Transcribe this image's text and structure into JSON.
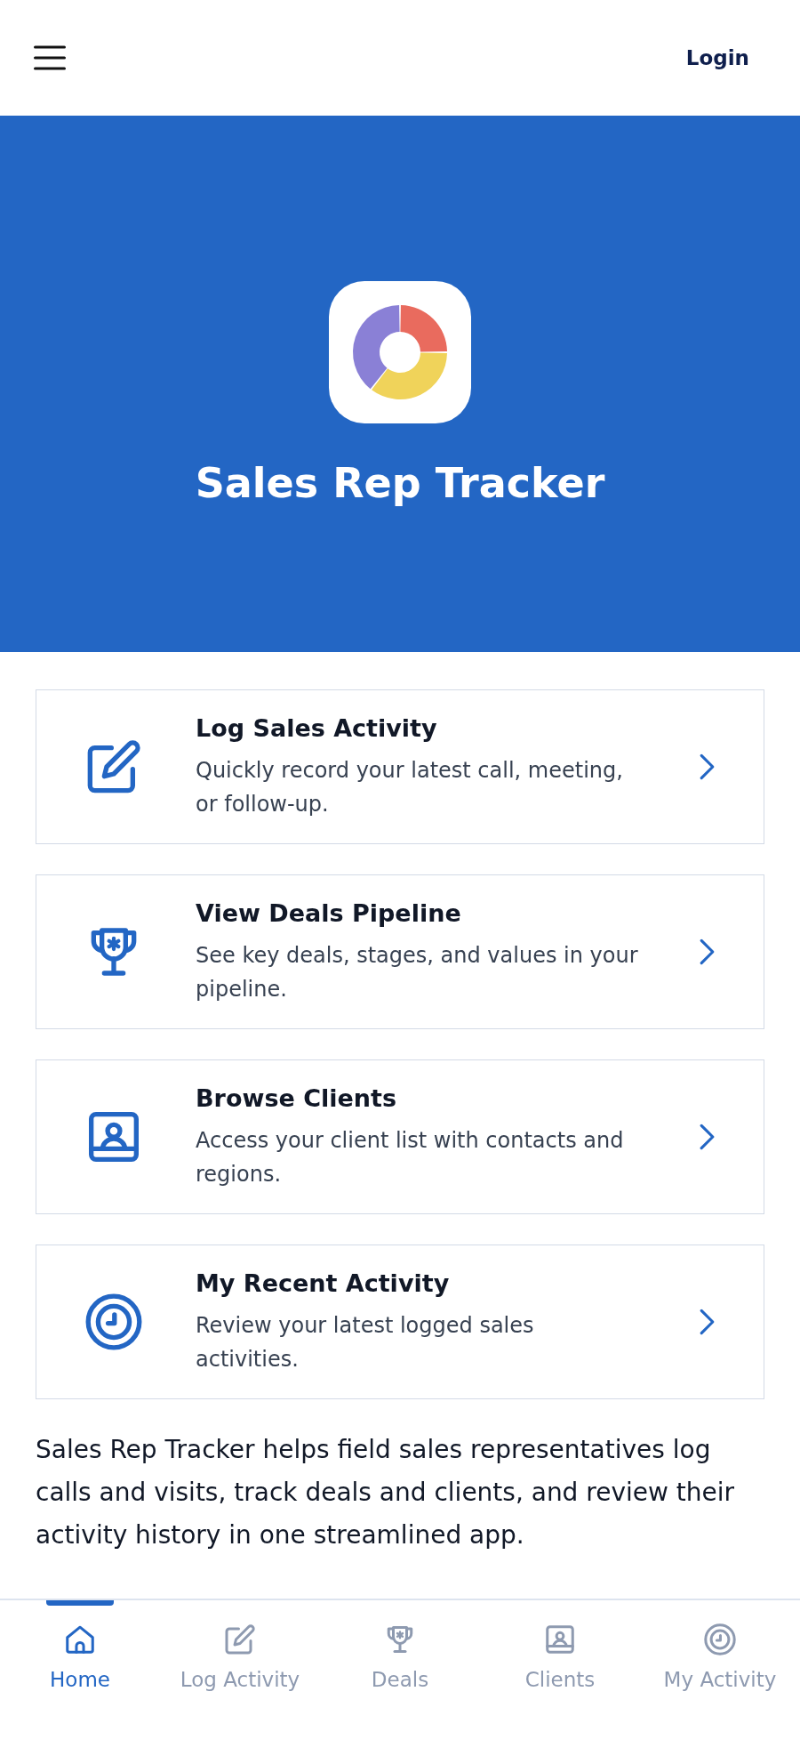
{
  "top_bar": {
    "login": "Login"
  },
  "hero": {
    "title": "Sales Rep Tracker"
  },
  "cards": [
    {
      "kind": "pencil",
      "title": "Log Sales Activity",
      "description": "Quickly record your latest call, meeting, or follow-up."
    },
    {
      "kind": "trophy",
      "title": "View Deals Pipeline",
      "description": "See key deals, stages, and values in your pipeline."
    },
    {
      "kind": "portrait",
      "title": "Browse Clients",
      "description": "Access your client list with contacts and regions."
    },
    {
      "kind": "clock",
      "title": "My Recent Activity",
      "description": "Review your latest logged sales activities."
    }
  ],
  "about": "Sales Rep Tracker helps field sales representatives log calls and visits, track deals and clients, and review their activity history in one streamlined app.",
  "bottom_nav": [
    {
      "kind": "home",
      "label": "Home",
      "selected": true
    },
    {
      "kind": "pencil",
      "label": "Log Activity",
      "selected": false
    },
    {
      "kind": "trophy",
      "label": "Deals",
      "selected": false
    },
    {
      "kind": "portrait",
      "label": "Clients",
      "selected": false
    },
    {
      "kind": "clock",
      "label": "My Activity",
      "selected": false
    }
  ]
}
